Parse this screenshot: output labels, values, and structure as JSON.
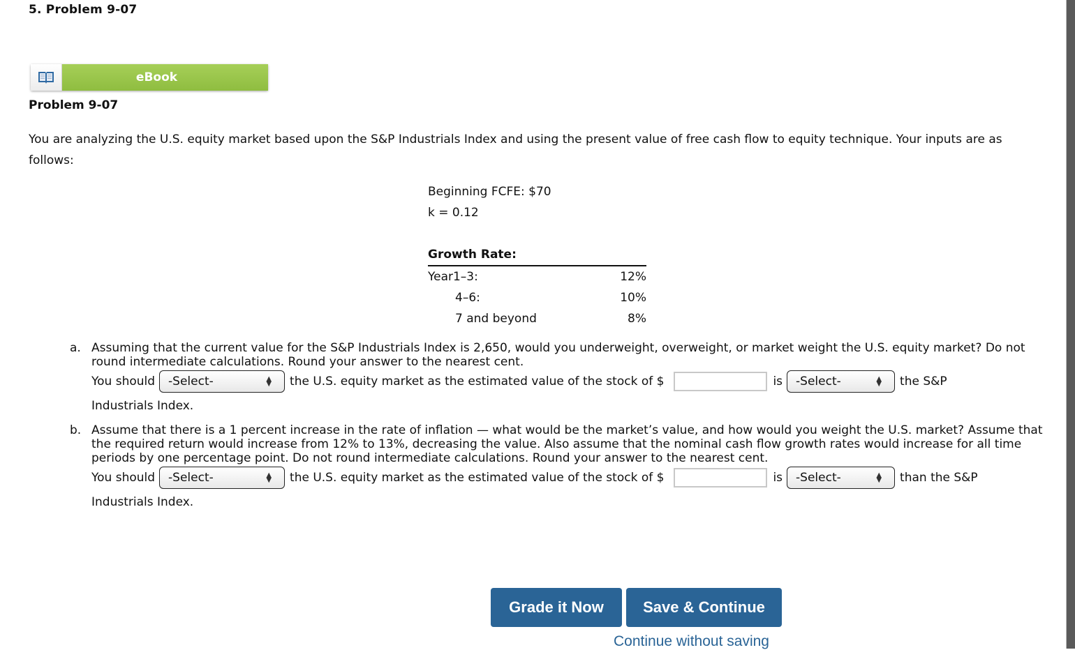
{
  "question_title": "5. Problem 9-07",
  "ebook": {
    "label": "eBook",
    "icon": "open-book-icon"
  },
  "problem_heading": "Problem 9-07",
  "intro": "You are analyzing the U.S. equity market based upon the S&P Industrials Index and using the present value of free cash flow to equity technique. Your inputs are as follows:",
  "inputs": {
    "fcfe": "Beginning FCFE: $70",
    "k": "k = 0.12"
  },
  "growth": {
    "heading": "Growth Rate:",
    "rows": [
      {
        "label": "Year1–3:",
        "value": "12%"
      },
      {
        "label": "4–6:",
        "value": "10%"
      },
      {
        "label": "7 and beyond",
        "value": "8%"
      }
    ]
  },
  "part_a": {
    "letter": "a.",
    "text": "Assuming that the current value for the S&P Industrials Index is 2,650, would you underweight, overweight, or market weight the U.S. equity market? Do not round intermediate calculations. Round your answer to the nearest cent.",
    "you_should": "You should",
    "select1": "-Select-",
    "middle": "the U.S. equity market as the estimated value of the stock of $",
    "input_value": "",
    "is": "is",
    "select2": "-Select-",
    "after": "the S&P",
    "tail": "Industrials Index."
  },
  "part_b": {
    "letter": "b.",
    "text": "Assume that there is a 1 percent increase in the rate of inflation — what would be the market’s value, and how would you weight the U.S. market? Assume that the required return would increase from 12% to 13%, decreasing the value. Also assume that the nominal cash flow growth rates would increase for all time periods by one percentage point. Do not round intermediate calculations. Round your answer to the nearest cent.",
    "you_should": "You should",
    "select1": "-Select-",
    "middle": "the U.S. equity market as the estimated value of the stock of $",
    "input_value": "",
    "is": "is",
    "select2": "-Select-",
    "after": "than the S&P",
    "tail": "Industrials Index."
  },
  "buttons": {
    "grade": "Grade it Now",
    "save": "Save & Continue",
    "continue": "Continue without saving"
  },
  "colors": {
    "button_blue": "#2a6496",
    "ebook_green": "#9bc64c"
  }
}
